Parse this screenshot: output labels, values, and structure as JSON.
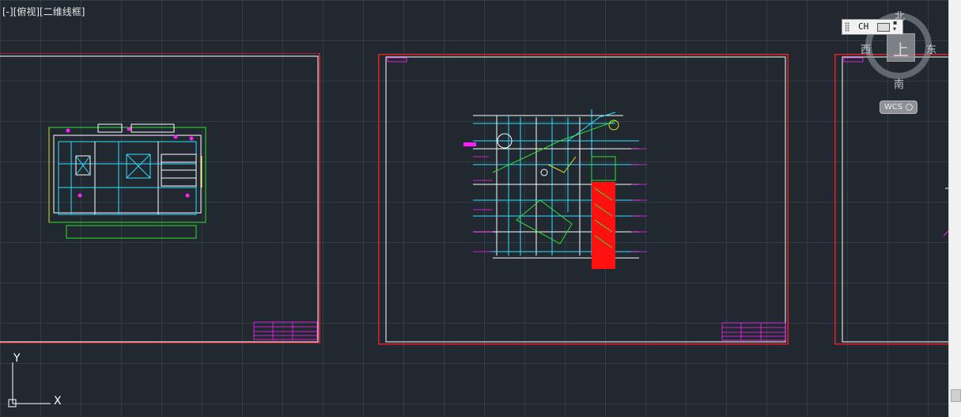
{
  "viewport": {
    "label": "[-][俯视][二维线框]"
  },
  "navcube": {
    "face": "上",
    "north": "北",
    "south": "南",
    "east": "东",
    "west": "西",
    "wcs": "WCS",
    "ime_lang": "CH"
  },
  "ucs": {
    "x": "X",
    "y": "Y"
  },
  "colors": {
    "background": "#212830",
    "frame_red": "#e0202a",
    "frame_white": "#ffffff",
    "cyan": "#30e0ff",
    "green": "#30e030",
    "magenta": "#ff20ff",
    "red_fill": "#ff1010",
    "yellow": "#e0e020"
  }
}
